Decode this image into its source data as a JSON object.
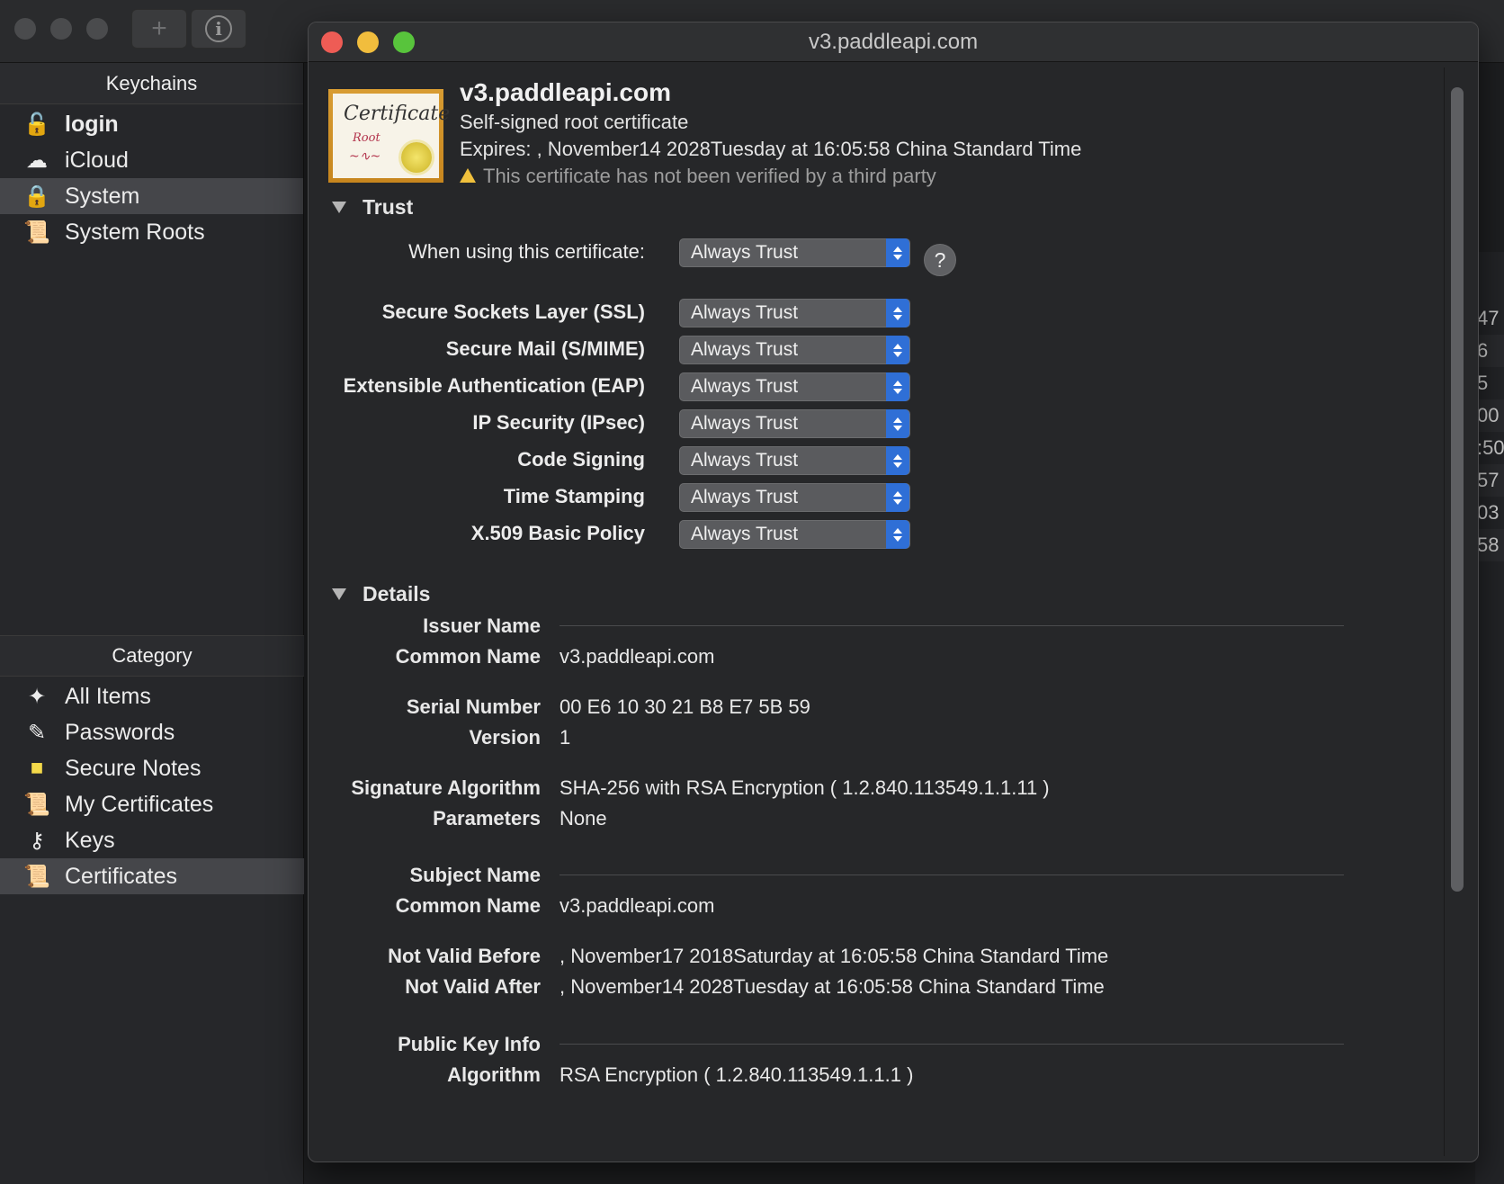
{
  "keychains_header": "Keychains",
  "keychains": [
    {
      "label": "login",
      "icon": "lock-open-icon",
      "glyph": "🔓"
    },
    {
      "label": "iCloud",
      "icon": "cloud-icon",
      "glyph": "☁"
    },
    {
      "label": "System",
      "icon": "lock-icon",
      "glyph": "🔒"
    },
    {
      "label": "System Roots",
      "icon": "certificate-icon",
      "glyph": "📜"
    }
  ],
  "category_header": "Category",
  "categories": [
    {
      "label": "All Items",
      "icon": "all-items-icon",
      "glyph": "✦"
    },
    {
      "label": "Passwords",
      "icon": "pen-icon",
      "glyph": "✎"
    },
    {
      "label": "Secure Notes",
      "icon": "note-icon",
      "glyph": "■"
    },
    {
      "label": "My Certificates",
      "icon": "certificate-icon",
      "glyph": "📜"
    },
    {
      "label": "Keys",
      "icon": "key-icon",
      "glyph": "⚷"
    },
    {
      "label": "Certificates",
      "icon": "certificate-icon",
      "glyph": "📜"
    }
  ],
  "bg_list_rows": [
    "47",
    "6",
    "5",
    "00",
    ":50",
    "57",
    "03",
    "58"
  ],
  "window": {
    "title": "v3.paddleapi.com"
  },
  "cert": {
    "name": "v3.paddleapi.com",
    "subtitle": "Self-signed root certificate",
    "expires": "Expires: , November14 2028Tuesday at 16:05:58 China Standard Time",
    "warning": "This certificate has not been verified by a third party",
    "thumb_title": "Certificate",
    "thumb_sub": "Root"
  },
  "trust": {
    "heading": "Trust",
    "when_using_label": "When using this certificate:",
    "when_using_value": "Always Trust",
    "help_label": "?",
    "policies": [
      {
        "label": "Secure Sockets Layer (SSL)",
        "value": "Always Trust"
      },
      {
        "label": "Secure Mail (S/MIME)",
        "value": "Always Trust"
      },
      {
        "label": "Extensible Authentication (EAP)",
        "value": "Always Trust"
      },
      {
        "label": "IP Security (IPsec)",
        "value": "Always Trust"
      },
      {
        "label": "Code Signing",
        "value": "Always Trust"
      },
      {
        "label": "Time Stamping",
        "value": "Always Trust"
      },
      {
        "label": "X.509 Basic Policy",
        "value": "Always Trust"
      }
    ]
  },
  "details": {
    "heading": "Details",
    "issuer_name": "Issuer Name",
    "issuer_cn_label": "Common Name",
    "issuer_cn": "v3.paddleapi.com",
    "serial_label": "Serial Number",
    "serial": "00 E6 10 30 21 B8 E7 5B 59",
    "version_label": "Version",
    "version": "1",
    "sig_alg_label": "Signature Algorithm",
    "sig_alg": "SHA-256 with RSA Encryption ( 1.2.840.113549.1.1.11 )",
    "params_label": "Parameters",
    "params": "None",
    "subject_name": "Subject Name",
    "subject_cn_label": "Common Name",
    "subject_cn": "v3.paddleapi.com",
    "not_before_label": "Not Valid Before",
    "not_before": ", November17 2018Saturday at 16:05:58 China Standard Time",
    "not_after_label": "Not Valid After",
    "not_after": ", November14 2028Tuesday at 16:05:58 China Standard Time",
    "pubkey_label": "Public Key Info",
    "algorithm_label": "Algorithm",
    "algorithm": "RSA Encryption ( 1.2.840.113549.1.1.1 )"
  }
}
